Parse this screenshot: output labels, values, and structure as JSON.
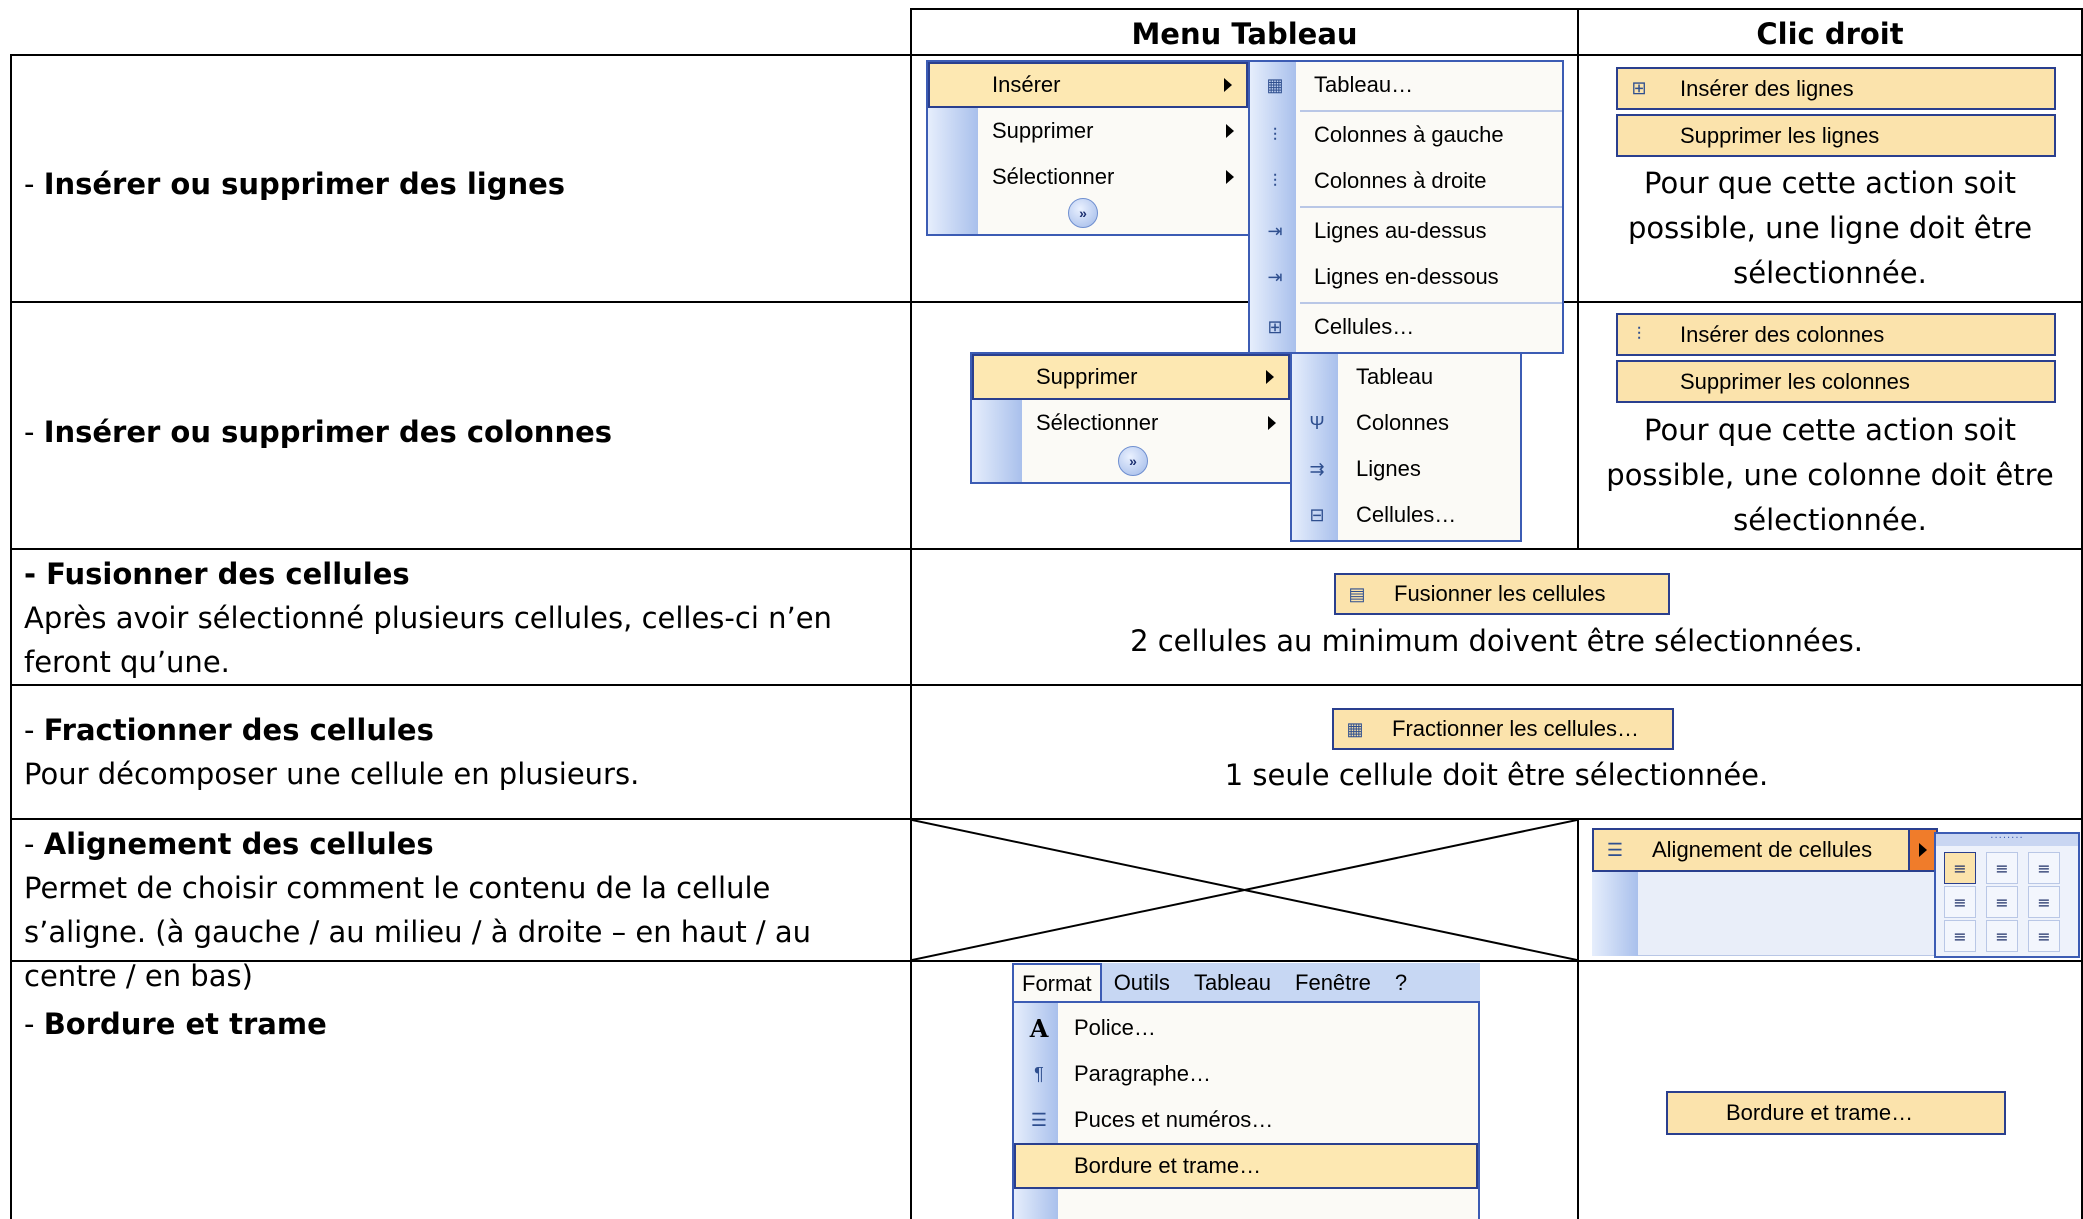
{
  "header": {
    "menu_col": "Menu Tableau",
    "click_col": "Clic droit"
  },
  "rows": {
    "r1": {
      "prefix": "- ",
      "title": "Insérer ou supprimer des lignes"
    },
    "r2": {
      "prefix": "- ",
      "title": "Insérer ou supprimer des colonnes"
    },
    "r3": {
      "title": "- Fusionner des cellules",
      "desc1": "Après avoir sélectionné plusieurs cellules, celles-ci n’en",
      "desc2": "feront qu’une."
    },
    "r4": {
      "prefix": "- ",
      "title": "Fractionner des cellules",
      "desc1": "Pour décomposer une cellule en plusieurs."
    },
    "r5": {
      "prefix": "- ",
      "title": "Alignement des cellules",
      "desc1": "Permet de choisir comment le contenu de la cellule",
      "desc2": "s’aligne. (à gauche / au milieu / à droite – en haut / au",
      "desc3": "centre / en bas)"
    },
    "r6": {
      "prefix": "- ",
      "title": "Bordure et trame"
    }
  },
  "menu_insert": {
    "items": [
      "Insérer",
      "Supprimer",
      "Sélectionner"
    ],
    "submenu": [
      "Tableau…",
      "Colonnes à gauche",
      "Colonnes à droite",
      "Lignes au-dessus",
      "Lignes en-dessous",
      "Cellules…"
    ]
  },
  "menu_delete": {
    "items": [
      "Supprimer",
      "Sélectionner"
    ],
    "submenu": [
      "Tableau",
      "Colonnes",
      "Lignes",
      "Cellules…"
    ]
  },
  "ctx_rows": {
    "insert": "Insérer des lignes",
    "delete": "Supprimer les lignes",
    "note1": "Pour que cette action soit",
    "note2": "possible, une ligne doit être",
    "note3": "sélectionnée."
  },
  "ctx_cols": {
    "insert": "Insérer des colonnes",
    "delete": "Supprimer les colonnes",
    "note1": "Pour que cette action soit",
    "note2": "possible, une colonne doit être",
    "note3": "sélectionnée."
  },
  "merge": {
    "label": "Fusionner les cellules",
    "note": "2 cellules au minimum doivent être sélectionnées."
  },
  "split": {
    "label": "Fractionner les cellules…",
    "note": "1 seule cellule doit être sélectionnée."
  },
  "align": {
    "label": "Alignement de cellules"
  },
  "format_menu": {
    "bar": [
      "Format",
      "Outils",
      "Tableau",
      "Fenêtre",
      "?"
    ],
    "items": [
      "Police…",
      "Paragraphe…",
      "Puces et numéros…",
      "Bordure et trame…"
    ]
  },
  "border_ctx": {
    "label": "Bordure et trame…"
  },
  "colors": {
    "menu_border": "#3c5cb4",
    "highlight": "#fbe3ac",
    "arrow_orange": "#f07c2a"
  }
}
